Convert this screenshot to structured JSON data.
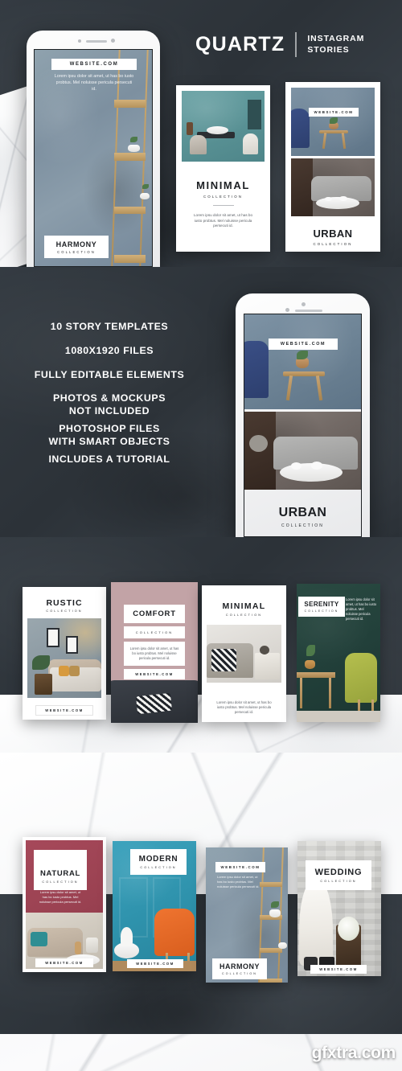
{
  "brand": {
    "name": "QUARTZ",
    "subtitle_line1": "INSTAGRAM",
    "subtitle_line2": "STORIES"
  },
  "features": [
    "10 STORY TEMPLATES",
    "1080X1920 FILES",
    "FULLY EDITABLE ELEMENTS",
    "PHOTOS & MOCKUPS\nNOT INCLUDED",
    "PHOTOSHOP FILES\nWITH SMART OBJECTS",
    "INCLUDES A TUTORIAL"
  ],
  "common": {
    "website": "WEBSITE.COM",
    "collection": "COLLECTION",
    "lorem": "Lorem ipsu dolor sit amet, ut has bo iusto probtus. Mel noluisse pericula persecuti id."
  },
  "templates": {
    "harmony": {
      "title": "HARMONY",
      "sub": "COLLECTION",
      "website": "WEBSITE.COM",
      "lorem": "Lorem ipsu dolor sit amet, ut has bo iusto probtus. Mel noluisse pericula persecuti id."
    },
    "minimal": {
      "title": "MINIMAL",
      "sub": "COLLECTION",
      "lorem": "Lorem ipsu dolor sit amet, ut has bo iusto probtus. Mel noluisse pericula persecuti id."
    },
    "urban": {
      "title": "URBAN",
      "sub": "COLLECTION",
      "website": "WEBSITE.COM"
    },
    "rustic": {
      "title": "RUSTIC",
      "sub": "COLLECTION",
      "website": "WEBSITE.COM"
    },
    "comfort": {
      "title": "COMFORT",
      "sub": "COLLECTION",
      "website": "WEBSITE.COM",
      "lorem": "Lorem ipsu dolor sit amet, ut has bo iusto probtus. Mel noluisse pericula persecuti id."
    },
    "minimal2": {
      "title": "MINIMAL",
      "sub": "COLLECTION",
      "lorem": "Lorem ipsu dolor sit amet, ut has bo iusto probtus. Mel noluisse pericula persecuti id."
    },
    "serenity": {
      "title": "SERENITY",
      "sub": "COLLECTION",
      "lorem": "Lorem ipsu dolor sit amet, ut has bo iusto probtus. Mel noluisse pericula persecuti id."
    },
    "natural": {
      "title": "NATURAL",
      "sub": "COLLECTION",
      "website": "WEBSITE.COM",
      "lorem": "Lorem ipsu dolor sit amet, ut has bo iusto probtus. Mel noluisse pericula persecuti id."
    },
    "modern": {
      "title": "MODERN",
      "sub": "COLLECTION",
      "website": "WEBSITE.COM"
    },
    "harmony2": {
      "title": "HARMONY",
      "sub": "COLLECTION",
      "website": "WEBSITE.COM",
      "lorem": "Lorem ipsu dolor sit amet, ut has bo iusto probtus. Mel noluisse pericula persecuti id."
    },
    "wedding": {
      "title": "WEDDING",
      "sub": "COLLECTION",
      "website": "WEBSITE.COM"
    }
  },
  "watermark": "gfxtra.com",
  "colors": {
    "dark": "#2f363c",
    "marble": "#f7f8f9",
    "comfort_pink": "#c2a3a6",
    "natural_red": "#9b4252",
    "serenity_green": "#22403a",
    "modern_teal": "#2f93ad"
  }
}
